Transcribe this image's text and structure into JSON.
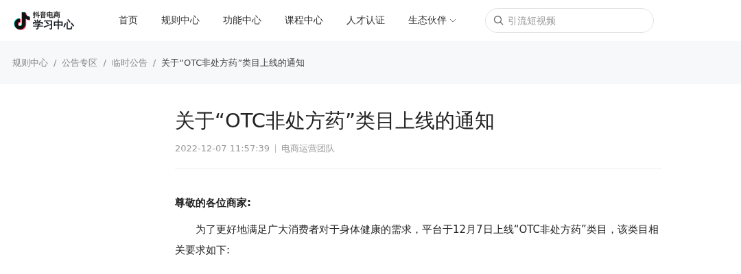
{
  "logo": {
    "subtitle": "抖音电商",
    "title": "学习中心"
  },
  "nav": [
    {
      "label": "首页",
      "kind": "link"
    },
    {
      "label": "规则中心",
      "kind": "link"
    },
    {
      "label": "功能中心",
      "kind": "link"
    },
    {
      "label": "课程中心",
      "kind": "link"
    },
    {
      "label": "人才认证",
      "kind": "link"
    },
    {
      "label": "生态伙伴",
      "kind": "dropdown"
    }
  ],
  "search": {
    "placeholder": "引流短视频"
  },
  "breadcrumb": [
    {
      "kind": "link",
      "label": "规则中心"
    },
    {
      "kind": "separator",
      "label": "/"
    },
    {
      "kind": "link",
      "label": "公告专区"
    },
    {
      "kind": "separator",
      "label": "/"
    },
    {
      "kind": "link",
      "label": "临时公告"
    },
    {
      "kind": "separator",
      "label": "/"
    },
    {
      "kind": "current",
      "label": "关于“OTC非处方药”类目上线的通知"
    }
  ],
  "article": {
    "title": "关于“OTC非处方药”类目上线的通知",
    "date": "2022-12-07 11:57:39",
    "author": "电商运营团队",
    "greeting": "尊敬的各位商家:",
    "paragraph": "为了更好地满足广大消费者对于身体健康的需求，平台于12月7日上线“OTC非处方药”类目，该类目相关要求如下:"
  }
}
